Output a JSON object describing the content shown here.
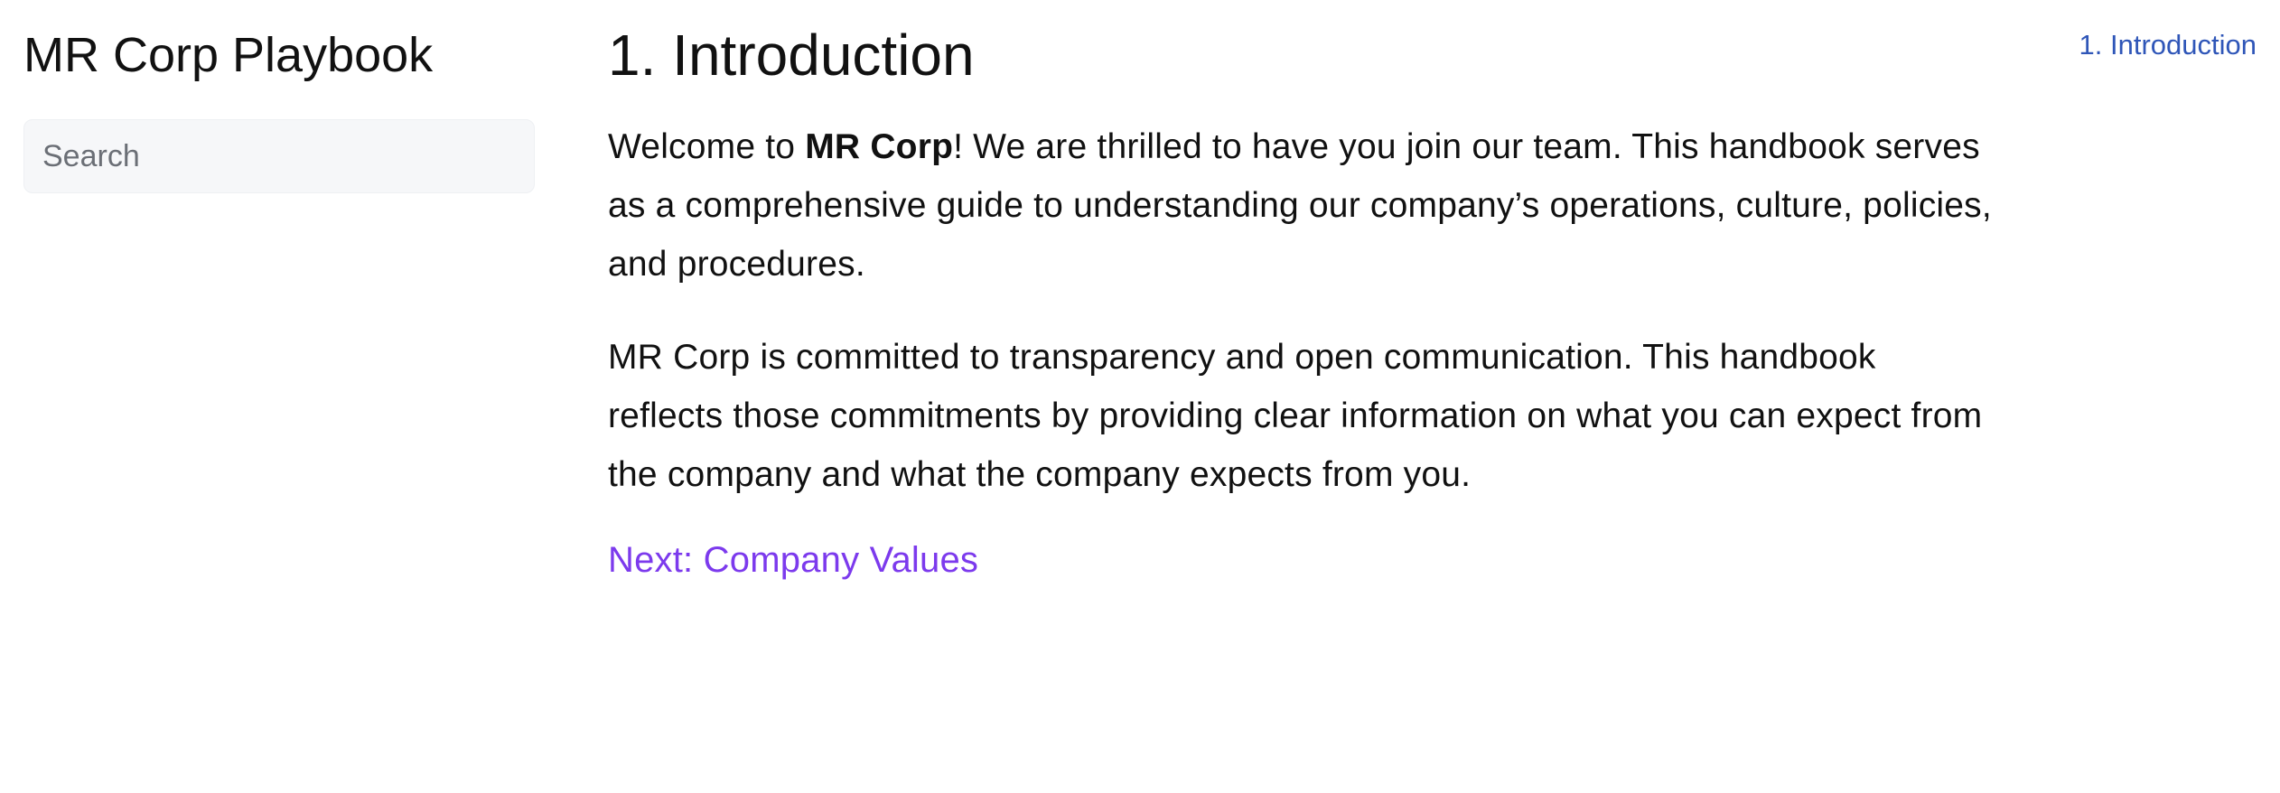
{
  "sidebar": {
    "site_title": "MR Corp Playbook",
    "search": {
      "placeholder": "Search",
      "value": ""
    }
  },
  "main": {
    "title": "1. Introduction",
    "paragraph1": {
      "before_bold": "Welcome to ",
      "bold": "MR Corp",
      "after_bold": "! We are thrilled to have you join our team. This handbook serves as a comprehensive guide to understanding our company’s operations, culture, policies, and procedures."
    },
    "paragraph2": "MR Corp is committed to transparency and open communication. This handbook reflects those commitments by providing clear information on what you can expect from the company and what the company expects from you.",
    "next_link": "Next: Company Values"
  },
  "toc": {
    "items": [
      {
        "label": "1. Introduction"
      }
    ]
  },
  "colors": {
    "link_accent": "#7c3aed",
    "toc_link": "#2f56b8",
    "search_bg": "#f6f7f9"
  }
}
